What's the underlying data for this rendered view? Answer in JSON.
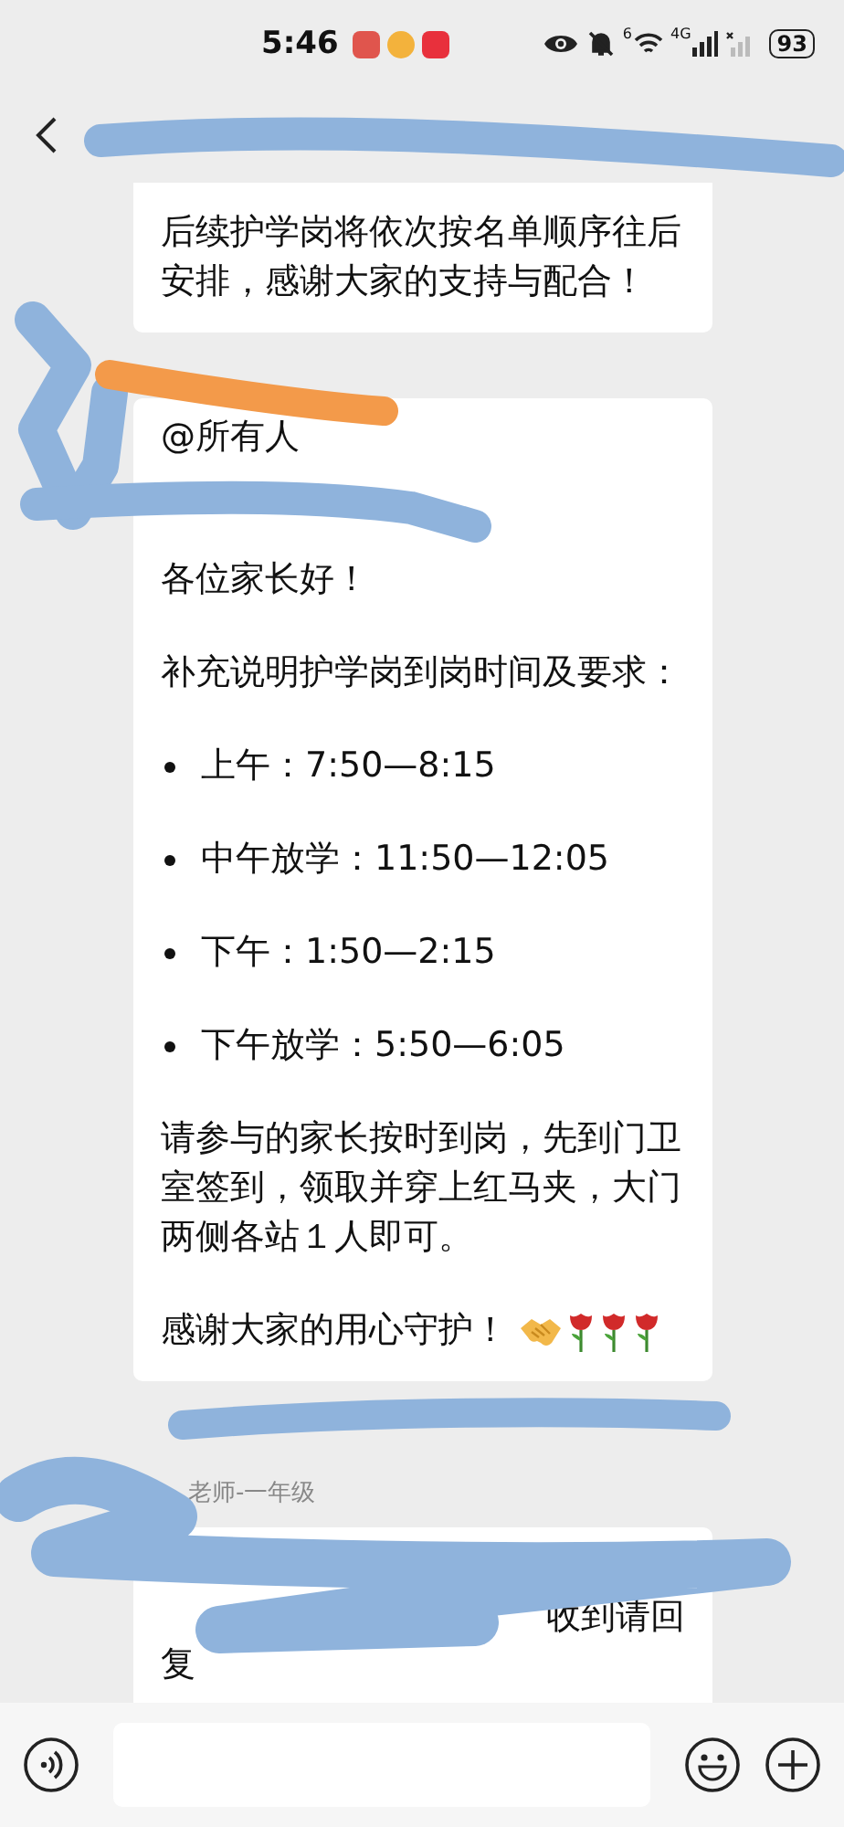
{
  "status_bar": {
    "time": "5:46",
    "network": "4G",
    "sim_mark": "6",
    "battery": "93"
  },
  "messages": [
    {
      "blocks": [
        {
          "kind": "para",
          "text": "后续护学岗将依次按名单顺序往后安排，感谢大家的支持与配合！"
        }
      ]
    },
    {
      "blocks": [
        {
          "kind": "mention",
          "text": "@所有人"
        },
        {
          "kind": "para",
          "text": "各位家长好！"
        },
        {
          "kind": "para",
          "text": "补充说明护学岗到岗时间及要求："
        },
        {
          "kind": "bullet",
          "text": "上午：7:50—8:15"
        },
        {
          "kind": "bullet",
          "text": "中午放学：11:50—12:05"
        },
        {
          "kind": "bullet",
          "text": "下午：1:50—2:15"
        },
        {
          "kind": "bullet",
          "text": "下午放学：5:50—6:05"
        },
        {
          "kind": "para",
          "text": "请参与的家长按时到岗，先到门卫室签到，领取并穿上红马夹，大门两侧各站１人即可。"
        },
        {
          "kind": "closing",
          "text": "感谢大家的用心守护！"
        }
      ]
    },
    {
      "sender": "老师-一年级",
      "blocks": [
        {
          "kind": "tail",
          "text": "收到请回复"
        }
      ]
    }
  ]
}
